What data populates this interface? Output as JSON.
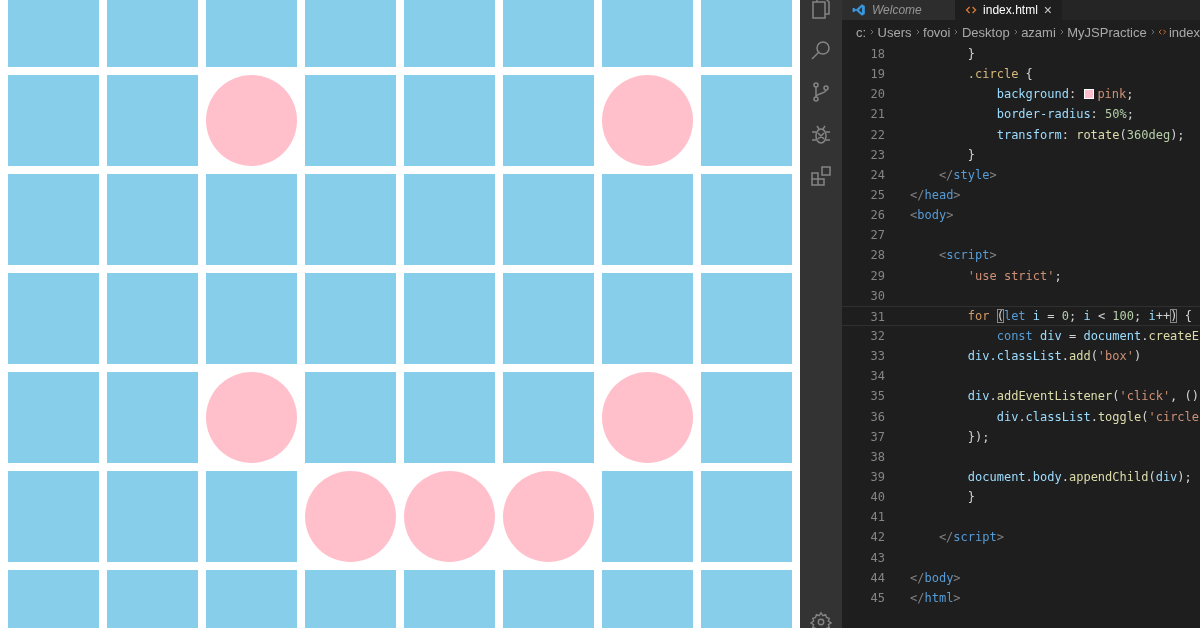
{
  "board": {
    "rows": [
      {
        "cells": [
          {
            "circle": false
          },
          {
            "circle": false
          },
          {
            "circle": false
          },
          {
            "circle": false
          },
          {
            "circle": false
          },
          {
            "circle": false
          },
          {
            "circle": false
          },
          {
            "circle": false
          }
        ]
      },
      {
        "cells": [
          {
            "circle": false
          },
          {
            "circle": false
          },
          {
            "circle": true
          },
          {
            "circle": false
          },
          {
            "circle": false
          },
          {
            "circle": false
          },
          {
            "circle": true
          },
          {
            "circle": false
          }
        ]
      },
      {
        "cells": [
          {
            "circle": false
          },
          {
            "circle": false
          },
          {
            "circle": false
          },
          {
            "circle": false
          },
          {
            "circle": false
          },
          {
            "circle": false
          },
          {
            "circle": false
          },
          {
            "circle": false
          }
        ]
      },
      {
        "cells": [
          {
            "circle": false
          },
          {
            "circle": false
          },
          {
            "circle": false
          },
          {
            "circle": false
          },
          {
            "circle": false
          },
          {
            "circle": false
          },
          {
            "circle": false
          },
          {
            "circle": false
          }
        ]
      },
      {
        "cells": [
          {
            "circle": false
          },
          {
            "circle": false
          },
          {
            "circle": true
          },
          {
            "circle": false
          },
          {
            "circle": false
          },
          {
            "circle": false
          },
          {
            "circle": true
          },
          {
            "circle": false
          }
        ]
      },
      {
        "cells": [
          {
            "circle": false
          },
          {
            "circle": false
          },
          {
            "circle": false
          },
          {
            "circle": true
          },
          {
            "circle": true
          },
          {
            "circle": true
          },
          {
            "circle": false
          },
          {
            "circle": false
          }
        ]
      },
      {
        "cells": [
          {
            "circle": false
          },
          {
            "circle": false
          },
          {
            "circle": false
          },
          {
            "circle": false
          },
          {
            "circle": false
          },
          {
            "circle": false
          },
          {
            "circle": false
          },
          {
            "circle": false
          }
        ]
      }
    ]
  },
  "editor": {
    "tabs": [
      {
        "label": "Welcome",
        "selected": false
      },
      {
        "label": "index.html",
        "selected": true,
        "close": "×"
      }
    ],
    "breadcrumbs": [
      "c:",
      "Users",
      "fovoi",
      "Desktop",
      "azami",
      "MyJSPractice",
      "index"
    ],
    "lines": [
      {
        "children": [
          {
            "children": [
              {
                "number": "18",
                "tokens": [
                  {
                    "kind": "plain",
                    "text": "}"
                  }
                ]
              },
              {
                "number": "19",
                "tokens": [
                  {
                    "kind": "selector",
                    "text": ".circle"
                  },
                  {
                    "kind": "plain",
                    "text": " {"
                  }
                ],
                "children": [
                  {
                    "number": "20",
                    "tokens": [
                      {
                        "kind": "property",
                        "text": "background"
                      },
                      {
                        "kind": "plain",
                        "text": ": "
                      },
                      {
                        "kind": "swatch",
                        "color": "#ffc0cb"
                      },
                      {
                        "kind": "value",
                        "text": "pink"
                      },
                      {
                        "kind": "plain",
                        "text": ";"
                      }
                    ]
                  },
                  {
                    "number": "21",
                    "tokens": [
                      {
                        "kind": "property",
                        "text": "border-radius"
                      },
                      {
                        "kind": "plain",
                        "text": ": "
                      },
                      {
                        "kind": "number",
                        "text": "50%"
                      },
                      {
                        "kind": "plain",
                        "text": ";"
                      }
                    ]
                  },
                  {
                    "number": "22",
                    "tokens": [
                      {
                        "kind": "property",
                        "text": "transform"
                      },
                      {
                        "kind": "plain",
                        "text": ": "
                      },
                      {
                        "kind": "function",
                        "text": "rotate"
                      },
                      {
                        "kind": "plain",
                        "text": "("
                      },
                      {
                        "kind": "number",
                        "text": "360deg"
                      },
                      {
                        "kind": "plain",
                        "text": ");"
                      }
                    ]
                  }
                ]
              },
              {
                "number": "23",
                "tokens": [
                  {
                    "kind": "plain",
                    "text": "}"
                  }
                ]
              }
            ]
          },
          {
            "number": "24",
            "tokens": [
              {
                "kind": "punct",
                "text": "</"
              },
              {
                "kind": "tag",
                "text": "style"
              },
              {
                "kind": "punct",
                "text": ">"
              }
            ]
          }
        ]
      },
      {
        "number": "25",
        "tokens": [
          {
            "kind": "punct",
            "text": "</"
          },
          {
            "kind": "tag",
            "text": "head"
          },
          {
            "kind": "punct",
            "text": ">"
          }
        ]
      },
      {
        "number": "26",
        "tokens": [
          {
            "kind": "punct",
            "text": "<"
          },
          {
            "kind": "tag",
            "text": "body"
          },
          {
            "kind": "punct",
            "text": ">"
          }
        ],
        "children": [
          {
            "number": "27"
          },
          {
            "number": "28",
            "tokens": [
              {
                "kind": "punct",
                "text": "<"
              },
              {
                "kind": "tag",
                "text": "script"
              },
              {
                "kind": "punct",
                "text": ">"
              }
            ],
            "children": [
              {
                "number": "29",
                "tokens": [
                  {
                    "kind": "string",
                    "text": "'use strict'"
                  },
                  {
                    "kind": "plain",
                    "text": ";"
                  }
                ]
              },
              {
                "number": "30"
              },
              {
                "number": "31",
                "current": true,
                "tokens": [
                  {
                    "kind": "control",
                    "text": "for "
                  },
                  {
                    "kind": "match",
                    "text": "("
                  },
                  {
                    "kind": "keyword",
                    "text": "let"
                  },
                  {
                    "kind": "variable",
                    "text": " i"
                  },
                  {
                    "kind": "plain",
                    "text": " = "
                  },
                  {
                    "kind": "number",
                    "text": "0"
                  },
                  {
                    "kind": "plain",
                    "text": "; "
                  },
                  {
                    "kind": "variable",
                    "text": "i"
                  },
                  {
                    "kind": "plain",
                    "text": " < "
                  },
                  {
                    "kind": "number",
                    "text": "100"
                  },
                  {
                    "kind": "plain",
                    "text": "; "
                  },
                  {
                    "kind": "variable",
                    "text": "i"
                  },
                  {
                    "kind": "plain",
                    "text": "++"
                  },
                  {
                    "kind": "match",
                    "text": ")"
                  },
                  {
                    "kind": "plain",
                    "text": " {"
                  }
                ],
                "children": [
                  {
                    "number": "32",
                    "tokens": [
                      {
                        "kind": "keyword",
                        "text": "const"
                      },
                      {
                        "kind": "variable",
                        "text": " div"
                      },
                      {
                        "kind": "plain",
                        "text": " = "
                      },
                      {
                        "kind": "variable",
                        "text": "document"
                      },
                      {
                        "kind": "plain",
                        "text": "."
                      },
                      {
                        "kind": "function",
                        "text": "createE"
                      }
                    ]
                  }
                ]
              },
              {
                "number": "33",
                "tokens": [
                  {
                    "kind": "variable",
                    "text": "div.classList"
                  },
                  {
                    "kind": "plain",
                    "text": "."
                  },
                  {
                    "kind": "function",
                    "text": "add"
                  },
                  {
                    "kind": "plain",
                    "text": "("
                  },
                  {
                    "kind": "string",
                    "text": "'box'"
                  },
                  {
                    "kind": "plain",
                    "text": ")"
                  }
                ]
              },
              {
                "number": "34"
              },
              {
                "number": "35",
                "tokens": [
                  {
                    "kind": "variable",
                    "text": "div"
                  },
                  {
                    "kind": "plain",
                    "text": "."
                  },
                  {
                    "kind": "function",
                    "text": "addEventListener"
                  },
                  {
                    "kind": "plain",
                    "text": "("
                  },
                  {
                    "kind": "string",
                    "text": "'click'"
                  },
                  {
                    "kind": "plain",
                    "text": ", ()"
                  }
                ],
                "children": [
                  {
                    "number": "36",
                    "tokens": [
                      {
                        "kind": "variable",
                        "text": "div"
                      },
                      {
                        "kind": "plain",
                        "text": "."
                      },
                      {
                        "kind": "variable",
                        "text": "classList"
                      },
                      {
                        "kind": "plain",
                        "text": "."
                      },
                      {
                        "kind": "function",
                        "text": "toggle"
                      },
                      {
                        "kind": "plain",
                        "text": "("
                      },
                      {
                        "kind": "string",
                        "text": "'circle"
                      }
                    ]
                  }
                ]
              },
              {
                "number": "37",
                "tokens": [
                  {
                    "kind": "plain",
                    "text": "});"
                  }
                ]
              },
              {
                "number": "38"
              },
              {
                "number": "39",
                "tokens": [
                  {
                    "kind": "variable",
                    "text": "document"
                  },
                  {
                    "kind": "plain",
                    "text": "."
                  },
                  {
                    "kind": "variable",
                    "text": "body"
                  },
                  {
                    "kind": "plain",
                    "text": "."
                  },
                  {
                    "kind": "function",
                    "text": "appendChild"
                  },
                  {
                    "kind": "plain",
                    "text": "("
                  },
                  {
                    "kind": "variable",
                    "text": "div"
                  },
                  {
                    "kind": "plain",
                    "text": ");"
                  }
                ]
              },
              {
                "number": "40",
                "tokens": [
                  {
                    "kind": "plain",
                    "text": "}"
                  }
                ]
              },
              {
                "number": "41"
              }
            ]
          },
          {
            "number": "42",
            "tokens": [
              {
                "kind": "punct",
                "text": "</"
              },
              {
                "kind": "tag",
                "text": "script"
              },
              {
                "kind": "punct",
                "text": ">"
              }
            ]
          },
          {
            "number": "43"
          }
        ]
      },
      {
        "number": "44",
        "tokens": [
          {
            "kind": "punct",
            "text": "</"
          },
          {
            "kind": "tag",
            "text": "body"
          },
          {
            "kind": "punct",
            "text": ">"
          }
        ]
      },
      {
        "number": "45",
        "tokens": [
          {
            "kind": "punct",
            "text": "</"
          },
          {
            "kind": "tag",
            "text": "html"
          },
          {
            "kind": "punct",
            "text": ">"
          }
        ]
      }
    ]
  }
}
